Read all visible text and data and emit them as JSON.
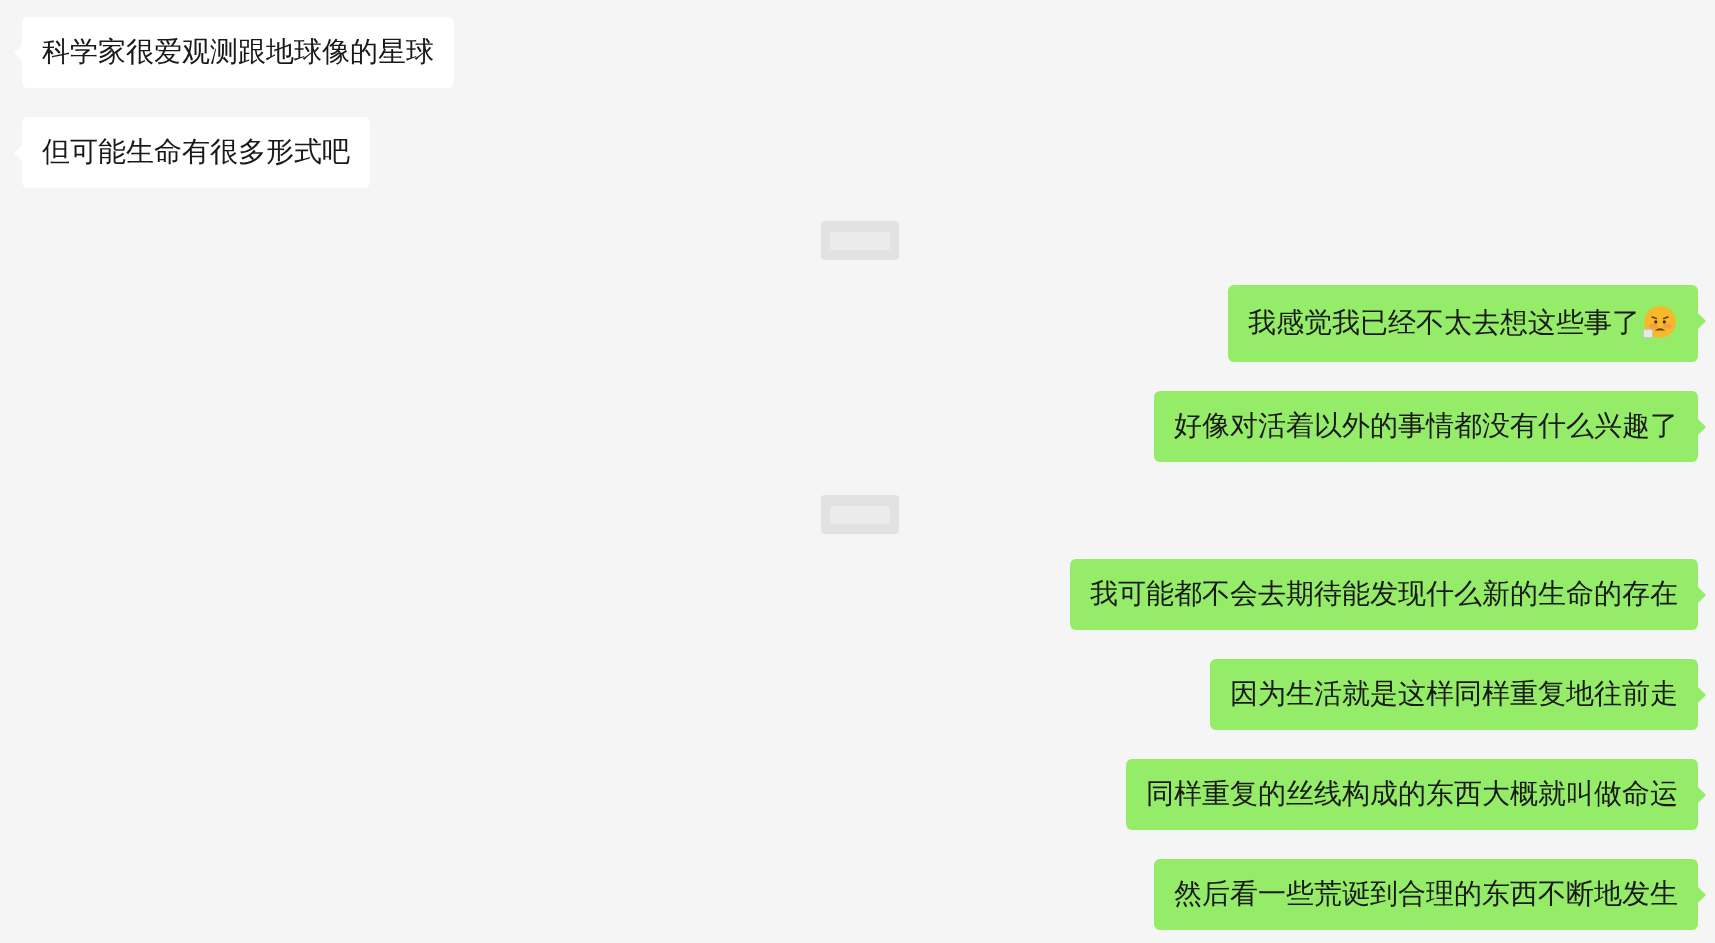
{
  "messages": [
    {
      "kind": "received",
      "text": "科学家很爱观测跟地球像的星球",
      "emoji": false
    },
    {
      "kind": "received",
      "text": "但可能生命有很多形式吧",
      "emoji": false
    },
    {
      "kind": "blurred"
    },
    {
      "kind": "sent",
      "text": "我感觉我已经不太去想这些事了",
      "emoji": true
    },
    {
      "kind": "sent",
      "text": "好像对活着以外的事情都没有什么兴趣了",
      "emoji": false
    },
    {
      "kind": "blurred"
    },
    {
      "kind": "sent",
      "text": "我可能都不会去期待能发现什么新的生命的存在",
      "emoji": false
    },
    {
      "kind": "sent",
      "text": "因为生活就是这样同样重复地往前走",
      "emoji": false
    },
    {
      "kind": "sent",
      "text": "同样重复的丝线构成的东西大概就叫做命运",
      "emoji": false
    },
    {
      "kind": "sent",
      "text": "然后看一些荒诞到合理的东西不断地发生",
      "emoji": false
    }
  ]
}
